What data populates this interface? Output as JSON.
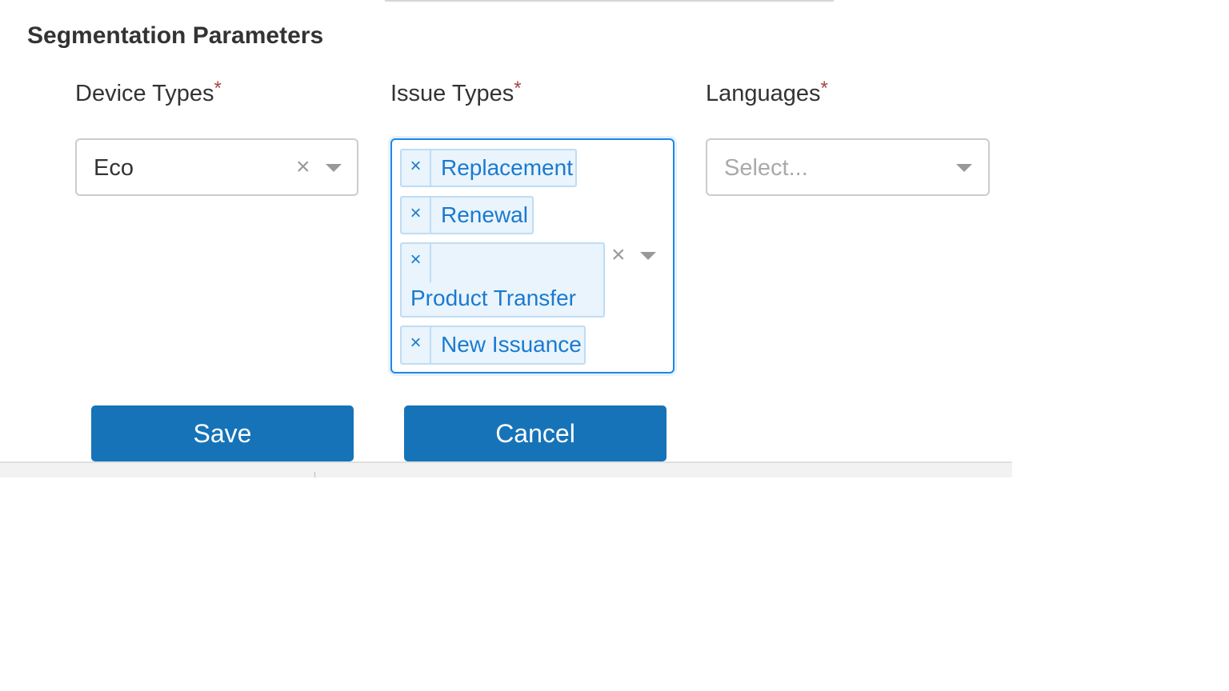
{
  "section": {
    "title": "Segmentation Parameters"
  },
  "fields": {
    "device_types": {
      "label": "Device Types",
      "required_mark": "*",
      "value": "Eco",
      "clear_glyph": "×"
    },
    "issue_types": {
      "label": "Issue Types",
      "required_mark": "*",
      "clear_glyph": "×",
      "chips": [
        {
          "label": "Replacement",
          "remove_glyph": "×"
        },
        {
          "label": "Renewal",
          "remove_glyph": "×"
        },
        {
          "label": "Product Transfer",
          "remove_glyph": "×"
        },
        {
          "label": "New Issuance",
          "remove_glyph": "×"
        }
      ]
    },
    "languages": {
      "label": "Languages",
      "required_mark": "*",
      "placeholder": "Select..."
    }
  },
  "actions": {
    "save_label": "Save",
    "cancel_label": "Cancel"
  },
  "icons": {
    "clear": "close-icon",
    "dropdown": "caret-down-icon"
  },
  "colors": {
    "primary_button": "#1673b8",
    "required": "#a94442",
    "chip_bg": "#eaf4fc",
    "chip_text": "#1a7ad0",
    "focus_border": "#1e88e5"
  }
}
